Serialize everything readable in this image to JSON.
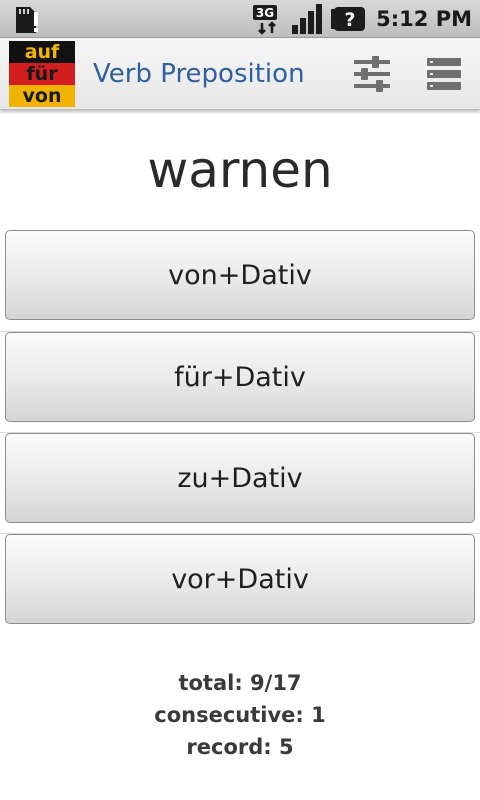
{
  "status_bar": {
    "time": "5:12 PM",
    "network": "3G",
    "icons": [
      "sd-card-warning-icon",
      "3g-data-icon",
      "signal-strength-icon",
      "battery-unknown-icon"
    ]
  },
  "action_bar": {
    "logo_lines": [
      "auf",
      "für",
      "von"
    ],
    "title": "Verb Preposition",
    "icons": [
      "settings-sliders-icon",
      "menu-list-icon"
    ]
  },
  "quiz": {
    "verb": "warnen",
    "answers": [
      {
        "label": "von+Dativ"
      },
      {
        "label": "für+Dativ"
      },
      {
        "label": "zu+Dativ"
      },
      {
        "label": "vor+Dativ"
      }
    ]
  },
  "stats": {
    "total": "total: 9/17",
    "consecutive": "consecutive: 1",
    "record": "record: 5"
  },
  "colors": {
    "title_blue": "#2f5f9e",
    "flag_black": "#111111",
    "flag_red": "#d21e1e",
    "flag_gold": "#f0b400"
  }
}
